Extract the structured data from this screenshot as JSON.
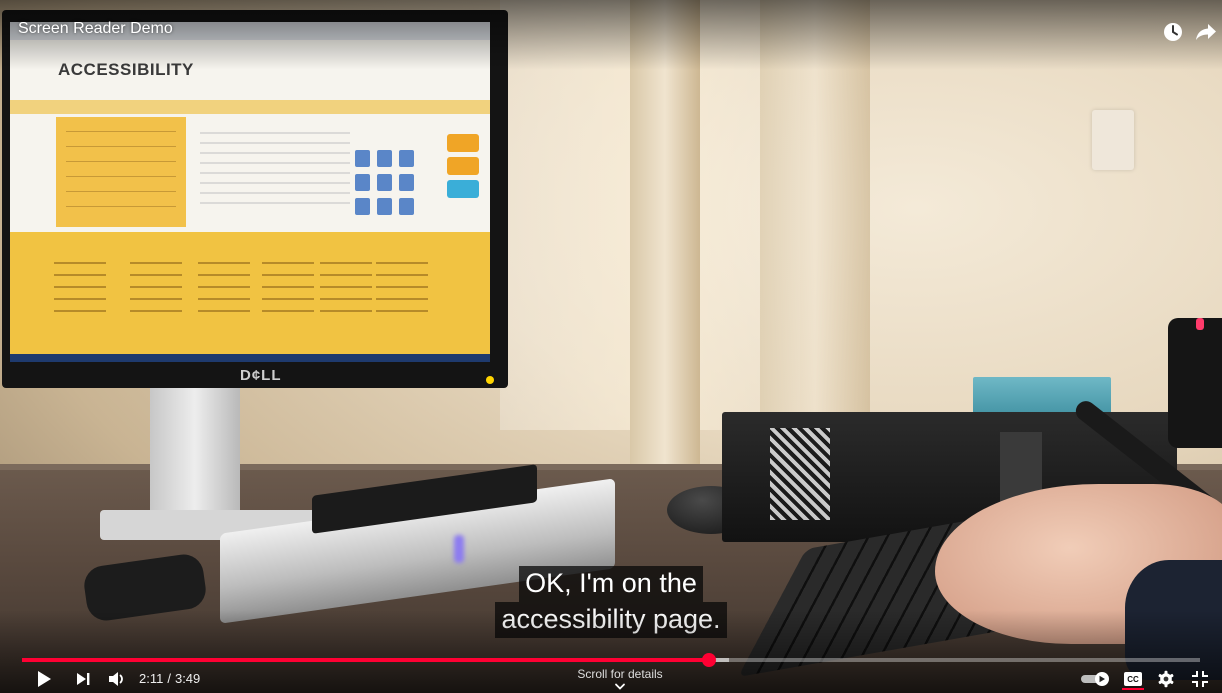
{
  "video": {
    "title": "Screen Reader Demo"
  },
  "scene": {
    "screen_heading": "ACCESSIBILITY",
    "monitor_brand": "D¢LL"
  },
  "captions": {
    "lines": [
      "OK, I'm on the",
      "accessibility page."
    ]
  },
  "controls": {
    "current_time": "2:11",
    "separator": "/",
    "duration": "3:49",
    "scroll_hint": "Scroll for details",
    "progress_fraction": 0.583,
    "loaded_fraction": 0.6,
    "captions_on": true,
    "autoplay_on": true
  },
  "icons": {
    "top_right": [
      "clock-icon",
      "share-icon"
    ],
    "bottom_left": [
      "play-icon",
      "next-icon",
      "volume-icon"
    ],
    "bottom_right": [
      "autoplay-toggle-icon",
      "captions-icon",
      "settings-gear-icon",
      "exit-fullscreen-icon"
    ]
  },
  "colors": {
    "progress_played": "#ff0033",
    "caption_background": "#080808",
    "text": "#ffffff"
  }
}
